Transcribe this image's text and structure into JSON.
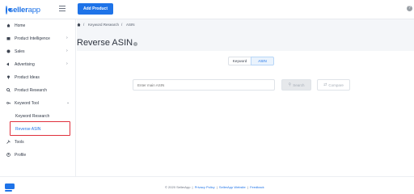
{
  "brand": {
    "name_a": "seller",
    "name_b": "app"
  },
  "colors": {
    "accent": "#1e73e8",
    "highlight": "#e0303c",
    "bg": "#f4f6f9"
  },
  "header": {
    "add_button": "Add Product"
  },
  "sidebar": {
    "items": [
      {
        "label": "Home",
        "icon": "home-icon"
      },
      {
        "label": "Product Intelligence",
        "icon": "box-icon",
        "chevron": "›"
      },
      {
        "label": "Sales",
        "icon": "sales-icon",
        "chevron": "›"
      },
      {
        "label": "Advertising",
        "icon": "advertising-icon",
        "chevron": "›"
      },
      {
        "label": "Product Ideas",
        "icon": "bulb-icon"
      },
      {
        "label": "Product Research",
        "icon": "search-icon"
      },
      {
        "label": "Keyword Tool",
        "icon": "key-icon",
        "chevron": "⌄"
      },
      {
        "label": "Keyword Research"
      },
      {
        "label": "Reverse ASIN"
      },
      {
        "label": "Tools",
        "icon": "tools-icon"
      },
      {
        "label": "Profile",
        "icon": "profile-icon"
      }
    ]
  },
  "breadcrumb": {
    "sep": "/",
    "item1": "Keyword Research",
    "item2": "ASIN"
  },
  "page": {
    "title": "Reverse ASIN",
    "info": "?"
  },
  "tabs": [
    {
      "label": "Keyword"
    },
    {
      "label": "ASIN"
    }
  ],
  "search": {
    "placeholder": "Enter main ASIN",
    "search_label": "Search",
    "compare_label": "Compare"
  },
  "footer": {
    "copyright": "© 2020 SellerApp",
    "sep": "|",
    "link1": "Privacy Policy",
    "link2": "SellerApp Website",
    "link3": "Feedback"
  }
}
